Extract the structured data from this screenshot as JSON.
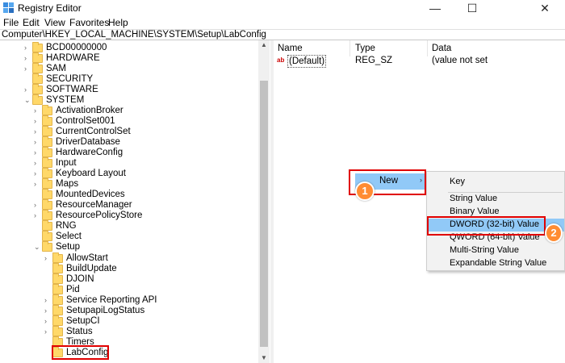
{
  "window": {
    "title": "Registry Editor",
    "icon": "registry-icon",
    "minimize_glyph": "—",
    "maximize_glyph": "☐",
    "close_glyph": "✕"
  },
  "menu": [
    "File",
    "Edit",
    "View",
    "Favorites",
    "Help"
  ],
  "address": "Computer\\HKEY_LOCAL_MACHINE\\SYSTEM\\Setup\\LabConfig",
  "tree": [
    {
      "label": "BCD00000000",
      "expander": "›"
    },
    {
      "label": "HARDWARE",
      "expander": "›"
    },
    {
      "label": "SAM",
      "expander": "›"
    },
    {
      "label": "SECURITY",
      "expander": ""
    },
    {
      "label": "SOFTWARE",
      "expander": "›"
    },
    {
      "label": "SYSTEM",
      "expander": "⌄"
    },
    {
      "label": "ActivationBroker",
      "expander": "›"
    },
    {
      "label": "ControlSet001",
      "expander": "›"
    },
    {
      "label": "CurrentControlSet",
      "expander": "›"
    },
    {
      "label": "DriverDatabase",
      "expander": "›"
    },
    {
      "label": "HardwareConfig",
      "expander": "›"
    },
    {
      "label": "Input",
      "expander": "›"
    },
    {
      "label": "Keyboard Layout",
      "expander": "›"
    },
    {
      "label": "Maps",
      "expander": "›"
    },
    {
      "label": "MountedDevices",
      "expander": ""
    },
    {
      "label": "ResourceManager",
      "expander": "›"
    },
    {
      "label": "ResourcePolicyStore",
      "expander": "›"
    },
    {
      "label": "RNG",
      "expander": ""
    },
    {
      "label": "Select",
      "expander": ""
    },
    {
      "label": "Setup",
      "expander": "⌄"
    },
    {
      "label": "AllowStart",
      "expander": "›"
    },
    {
      "label": "BuildUpdate",
      "expander": ""
    },
    {
      "label": "DJOIN",
      "expander": ""
    },
    {
      "label": "Pid",
      "expander": ""
    },
    {
      "label": "Service Reporting API",
      "expander": "›"
    },
    {
      "label": "SetupapiLogStatus",
      "expander": "›"
    },
    {
      "label": "SetupCI",
      "expander": "›"
    },
    {
      "label": "Status",
      "expander": "›"
    },
    {
      "label": "Timers",
      "expander": ""
    },
    {
      "label": "LabConfig",
      "expander": ""
    }
  ],
  "list": {
    "columns": [
      "Name",
      "Type",
      "Data"
    ],
    "rows": [
      {
        "name": "(Default)",
        "type": "REG_SZ",
        "data": "(value not set"
      }
    ]
  },
  "context_menu": {
    "new_label": "New",
    "arrow": "›"
  },
  "submenu": [
    "Key",
    "String Value",
    "Binary Value",
    "DWORD (32-bit) Value",
    "QWORD (64-bit) Value",
    "Multi-String Value",
    "Expandable String Value"
  ],
  "badges": [
    "1",
    "2"
  ],
  "colors": {
    "highlight": "#91c9f7",
    "annotation_red": "#e00000",
    "badge_orange": "#ff8c33",
    "folder": "#ffd869"
  }
}
